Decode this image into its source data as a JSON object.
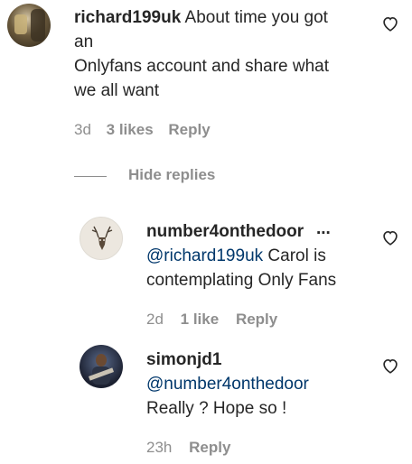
{
  "comments": [
    {
      "username": "richard199uk",
      "text_line1": "About time you got",
      "text_line2": "an",
      "text_line3": "Onlyfans account and share what",
      "text_line4": "we all want",
      "time": "3d",
      "likes": "3 likes",
      "reply_label": "Reply"
    }
  ],
  "replies_toggle": "Hide replies",
  "replies": [
    {
      "username": "number4onthedoor",
      "username_overflow": "...",
      "mention": "@richard199uk",
      "text_inline": "Carol is",
      "text_line2": "contemplating Only Fans",
      "time": "2d",
      "likes": "1 like",
      "reply_label": "Reply"
    },
    {
      "username": "simonjd1",
      "mention": "@number4onthedoor",
      "text_line2": "Really ? Hope so !",
      "time": "23h",
      "reply_label": "Reply"
    }
  ],
  "icons": {
    "like": "heart-outline-icon"
  }
}
